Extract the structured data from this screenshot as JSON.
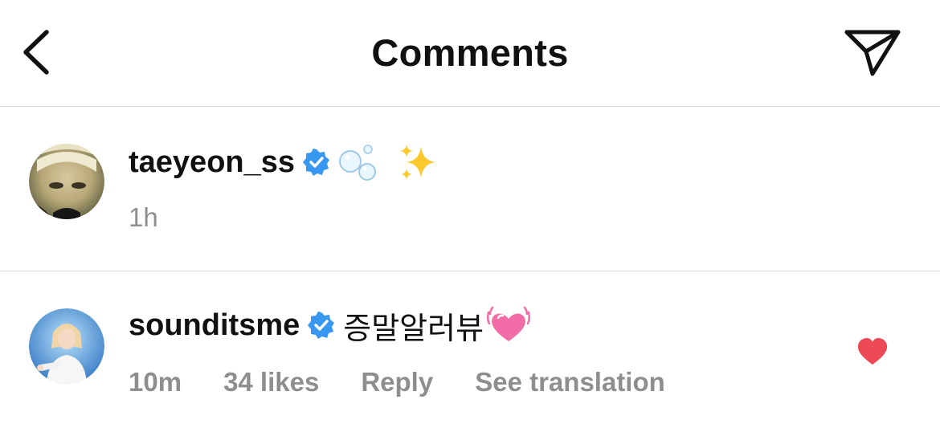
{
  "header": {
    "title": "Comments",
    "back_icon": "chevron-left-icon",
    "share_icon": "paper-plane-icon"
  },
  "post": {
    "username": "taeyeon_ss",
    "verified": true,
    "caption_emojis": [
      "bubbles",
      "sparkles"
    ],
    "time": "1h"
  },
  "comments": [
    {
      "username": "sounditsme",
      "verified": true,
      "text": "증말알러뷰",
      "emoji": "beating-heart",
      "time": "10m",
      "likes": "34 likes",
      "reply_label": "Reply",
      "translate_label": "See translation",
      "liked": true
    }
  ],
  "colors": {
    "verified_blue": "#3897f0",
    "like_red": "#ed4956",
    "secondary_text": "#8e8e8e",
    "divider": "#dbdbdb"
  }
}
